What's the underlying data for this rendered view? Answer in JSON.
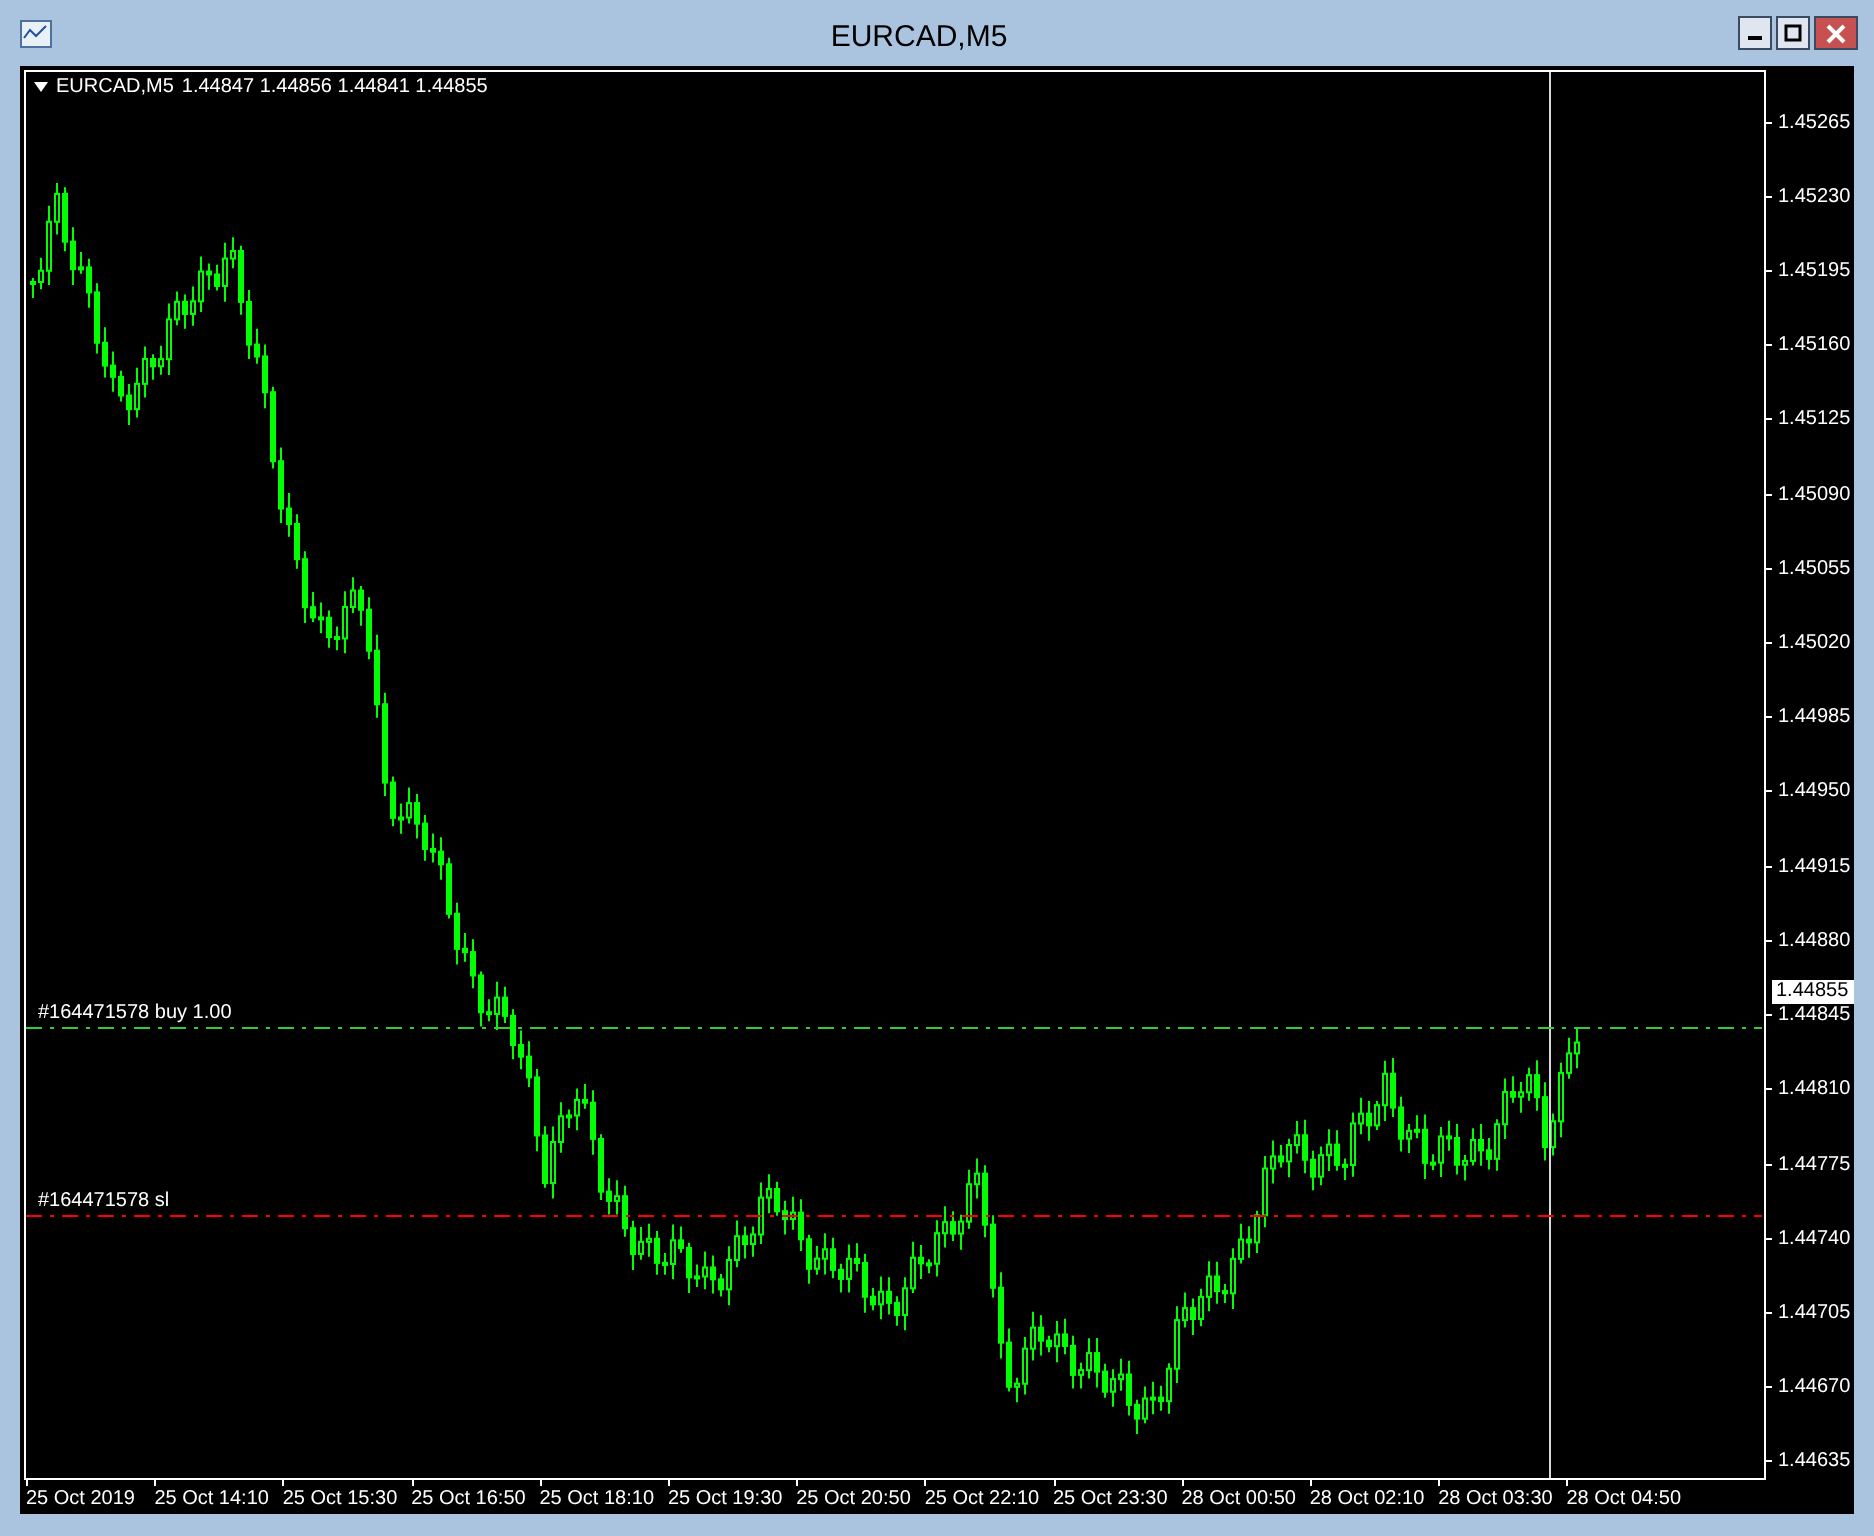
{
  "window": {
    "title": "EURCAD,M5"
  },
  "chart": {
    "symbol": "EURCAD,M5",
    "ohlc": "1.44847 1.44856 1.44841 1.44855",
    "price_axis": [
      "1.45265",
      "1.45230",
      "1.45195",
      "1.45160",
      "1.45125",
      "1.45090",
      "1.45055",
      "1.45020",
      "1.44985",
      "1.44950",
      "1.44915",
      "1.44880",
      "1.44845",
      "1.44810",
      "1.44775",
      "1.44740",
      "1.44705",
      "1.44670",
      "1.44635"
    ],
    "current_price": "1.44855",
    "time_axis": [
      "25 Oct 2019",
      "25 Oct 14:10",
      "25 Oct 15:30",
      "25 Oct 16:50",
      "25 Oct 18:10",
      "25 Oct 19:30",
      "25 Oct 20:50",
      "25 Oct 22:10",
      "25 Oct 23:30",
      "28 Oct 00:50",
      "28 Oct 02:10",
      "28 Oct 03:30",
      "28 Oct 04:50"
    ],
    "orders": [
      {
        "label": "#164471578 buy 1.00",
        "kind": "entry"
      },
      {
        "label": "#164471578 sl",
        "kind": "stop_loss"
      }
    ]
  }
}
